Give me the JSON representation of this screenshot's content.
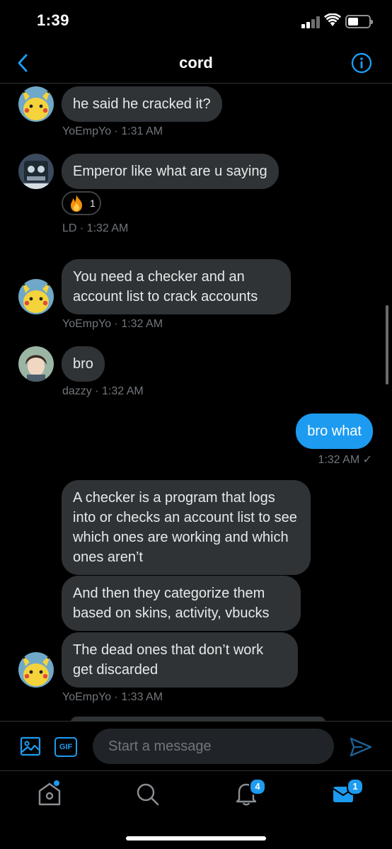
{
  "status_bar": {
    "time": "1:39"
  },
  "header": {
    "title": "cord"
  },
  "messages": [
    {
      "text": "he said he cracked it?",
      "sender": "YoEmpYo",
      "time": "1:31 AM"
    },
    {
      "text": "Emperor like what are u saying",
      "sender": "LD",
      "time": "1:32 AM",
      "reaction": {
        "emoji": "fire",
        "count": "1"
      }
    },
    {
      "text": "You need a checker and an account list to crack accounts",
      "sender": "YoEmpYo",
      "time": "1:32 AM"
    },
    {
      "text": "bro",
      "sender": "dazzy",
      "time": "1:32 AM"
    },
    {
      "text": "bro what",
      "time": "1:32 AM ✓",
      "sent": true
    },
    {
      "text": "A checker is a program that logs into or checks an account list to see which ones are working and which ones aren’t"
    },
    {
      "text": "And then they categorize them based on skins, activity, vbucks"
    },
    {
      "text": "The dead ones that don’t work get discarded",
      "sender": "YoEmpYo",
      "time": "1:33 AM"
    }
  ],
  "meta_separator": " · ",
  "composer": {
    "placeholder": "Start a message",
    "gif_label": "GIF"
  },
  "tabbar": {
    "notifications_badge": "4",
    "messages_badge": "1"
  },
  "colors": {
    "accent": "#1d9bf0",
    "bubble": "#2f3336",
    "background": "#000000",
    "meta": "#71767b"
  }
}
